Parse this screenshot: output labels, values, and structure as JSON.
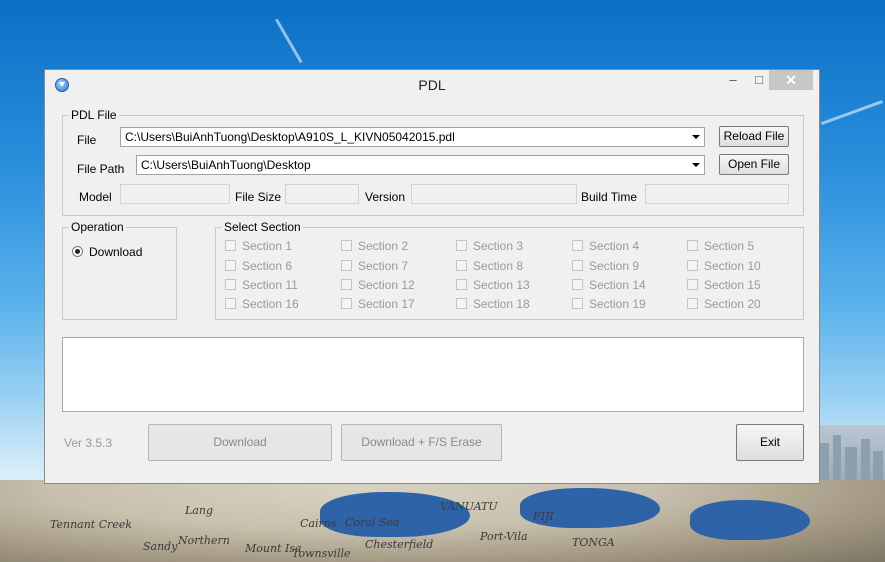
{
  "window": {
    "title": "PDL"
  },
  "pdl_file": {
    "group_label": "PDL File",
    "file_label": "File",
    "file_value": "C:\\Users\\BuiAnhTuong\\Desktop\\A910S_L_KIVN05042015.pdl",
    "path_label": "File Path",
    "path_value": "C:\\Users\\BuiAnhTuong\\Desktop",
    "reload_button": "Reload File",
    "open_button": "Open File",
    "model_label": "Model",
    "size_label": "File Size",
    "version_label": "Version",
    "build_label": "Build Time"
  },
  "operation": {
    "group_label": "Operation",
    "download_label": "Download"
  },
  "select_section": {
    "group_label": "Select Section",
    "sections": [
      "Section 1",
      "Section 2",
      "Section 3",
      "Section 4",
      "Section 5",
      "Section 6",
      "Section 7",
      "Section 8",
      "Section 9",
      "Section 10",
      "Section 11",
      "Section 12",
      "Section 13",
      "Section 14",
      "Section 15",
      "Section 16",
      "Section 17",
      "Section 18",
      "Section 19",
      "Section 20"
    ]
  },
  "footer": {
    "version": "Ver 3.5.3",
    "download_button": "Download",
    "download_erase_button": "Download + F/S Erase",
    "exit_button": "Exit"
  },
  "map_labels": [
    "Lang",
    "Northern",
    "Sandy",
    "Mount Isa",
    "Cairns",
    "Coral Sea",
    "VANUATU",
    "FIJI",
    "Port-Vila",
    "TONGA",
    "Chesterfield",
    "Townsville",
    "Tennant Creek"
  ]
}
